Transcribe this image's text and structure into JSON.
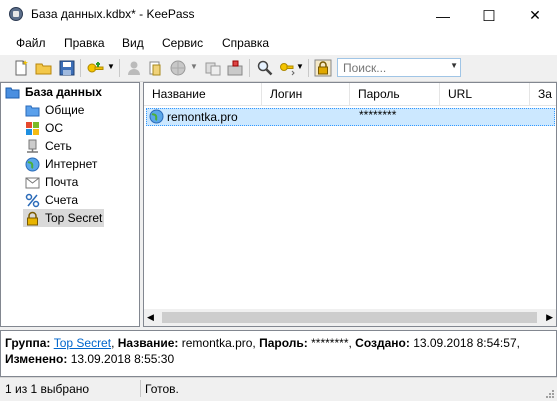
{
  "window": {
    "title": "База данных.kdbx* - KeePass",
    "controls": {
      "minimize": "—",
      "maximize": "☐",
      "close": "✕"
    }
  },
  "menu": [
    "Файл",
    "Правка",
    "Вид",
    "Сервис",
    "Справка"
  ],
  "toolbar": {
    "icons": [
      "new-database-icon",
      "open-database-icon",
      "save-icon",
      "add-entry-icon",
      "dropdown-arrow-icon",
      "copy-username-icon",
      "copy-password-icon",
      "open-url-icon",
      "sync-icon",
      "perform-auto-type-icon",
      "find-icon",
      "sort-icon",
      "lock-workspace-icon"
    ],
    "search_placeholder": "Поиск..."
  },
  "tree": {
    "root": "База данных",
    "groups": [
      "Общие",
      "ОС",
      "Сеть",
      "Интернет",
      "Почта",
      "Счета",
      "Top Secret"
    ],
    "selected": "Top Secret"
  },
  "list": {
    "columns": [
      "Название",
      "Логин",
      "Пароль",
      "URL",
      "За"
    ],
    "rows": [
      {
        "title": "remontka.pro",
        "login": "",
        "password": "********",
        "url": ""
      }
    ]
  },
  "details": {
    "group_label": "Группа:",
    "group_value": "Top Secret",
    "title_label": "Название:",
    "title_value": "remontka.pro,",
    "password_label": "Пароль:",
    "password_value": "********,",
    "created_label": "Создано:",
    "created_value": "13.09.2018 8:54:57,",
    "modified_label": "Изменено:",
    "modified_value": "13.09.2018 8:55:30"
  },
  "status": {
    "selection": "1 из 1 выбрано",
    "state": "Готов."
  },
  "colors": {
    "selection_bg": "#cce8ff",
    "selection_border": "#3399ff",
    "link": "#0066cc"
  }
}
